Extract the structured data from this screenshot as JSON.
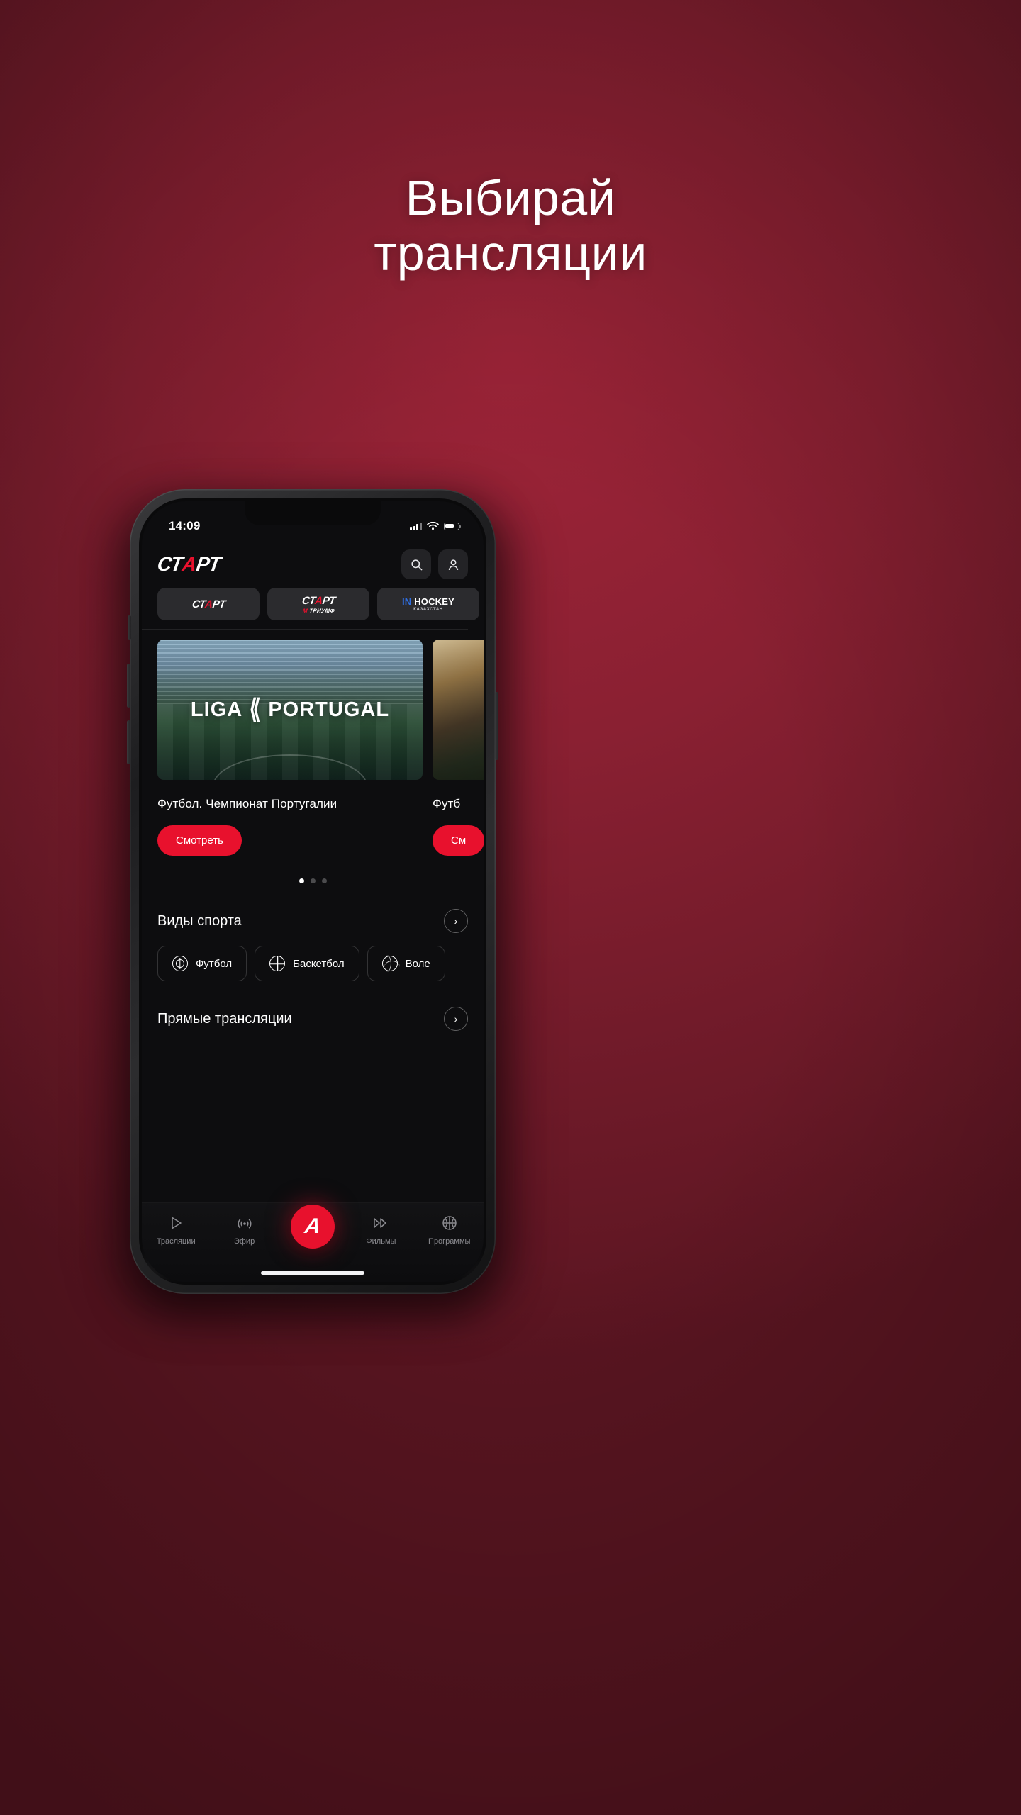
{
  "headline": {
    "line1": "Выбирай",
    "line2": "трансляции"
  },
  "colors": {
    "accent": "#e8112d",
    "bg_top": "#9e2438",
    "bg_bottom": "#5a1521",
    "surface": "#0d0d0f"
  },
  "phone": {
    "status_bar": {
      "time": "14:09",
      "signal_icon": "cellular-bars-icon",
      "wifi_icon": "wifi-icon",
      "battery_icon": "battery-icon"
    }
  },
  "app": {
    "logo": {
      "part1": "СТ",
      "accent": "А",
      "part2": "РТ"
    },
    "header_actions": [
      {
        "name": "search-icon",
        "label": "Поиск"
      },
      {
        "name": "profile-icon",
        "label": "Профиль"
      }
    ],
    "channels": [
      {
        "id": "start",
        "main_1": "СТ",
        "main_accent": "А",
        "main_2": "РТ",
        "sub": ""
      },
      {
        "id": "start-triumf",
        "main_1": "СТ",
        "main_accent": "А",
        "main_2": "РТ",
        "sub_accent": "М",
        "sub": "ТРИУМФ"
      },
      {
        "id": "in-hockey",
        "main_1": "IN ",
        "main_2": "HOCKEY",
        "sub": "КАЗАХСТАН"
      }
    ],
    "carousel": {
      "slides": [
        {
          "poster_text_1": "LIGA",
          "poster_text_2": "PORTUGAL",
          "title": "Футбол. Чемпионат Португалии",
          "button": "Смотреть"
        },
        {
          "poster_text_1": "",
          "poster_text_2": "",
          "title": "Футб",
          "button": "См"
        }
      ],
      "dots": {
        "count": 3,
        "active_index": 0
      }
    },
    "sections": [
      {
        "title": "Виды спорта",
        "arrow": "›",
        "chips": [
          {
            "label": "Футбол",
            "icon": "soccer-ball-icon"
          },
          {
            "label": "Баскетбол",
            "icon": "basketball-icon"
          },
          {
            "label": "Воле",
            "icon": "volleyball-icon"
          }
        ]
      },
      {
        "title": "Прямые трансляции",
        "arrow": "›"
      }
    ],
    "bottom_nav": [
      {
        "label": "Трасляции",
        "icon": "play-outline-icon"
      },
      {
        "label": "Эфир",
        "icon": "broadcast-icon"
      },
      {
        "label": "",
        "icon": "start-fab-icon",
        "fab_letter": "A"
      },
      {
        "label": "Фильмы",
        "icon": "fast-forward-icon"
      },
      {
        "label": "Программы",
        "icon": "basketball-outline-icon"
      }
    ]
  }
}
